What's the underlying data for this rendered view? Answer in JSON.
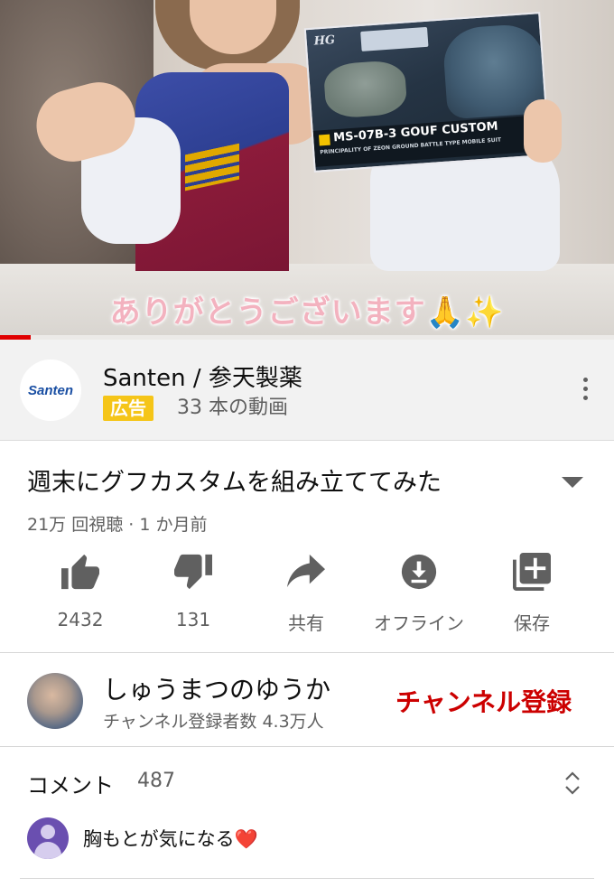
{
  "video": {
    "subtitle": "ありがとうございます🙏✨",
    "box": {
      "hg_mark": "HG",
      "model_name": "MS-07B-3 GOUF CUSTOM",
      "tagline": "PRINCIPALITY OF ZEON GROUND BATTLE TYPE MOBILE SUIT"
    },
    "progress_percent": 5
  },
  "ad": {
    "logo_text": "Santen",
    "title": "Santen / 参天製薬",
    "badge": "広告",
    "meta": "33 本の動画"
  },
  "video_info": {
    "title": "週末にグフカスタムを組み立ててみた",
    "meta": "21万 回視聴 · 1 か月前"
  },
  "actions": {
    "like_count": "2432",
    "dislike_count": "131",
    "share_label": "共有",
    "offline_label": "オフライン",
    "save_label": "保存"
  },
  "channel": {
    "name": "しゅうまつのゆうか",
    "subscribers": "チャンネル登録者数 4.3万人",
    "subscribe_label": "チャンネル登録"
  },
  "comments": {
    "header": "コメント",
    "count": "487",
    "first_comment": "胸もとが気になる",
    "first_comment_emoji": "❤️"
  },
  "colors": {
    "accent_red": "#cc0000",
    "progress_red": "#e00000",
    "ad_badge": "#f5c518",
    "secondary_text": "#606060"
  }
}
